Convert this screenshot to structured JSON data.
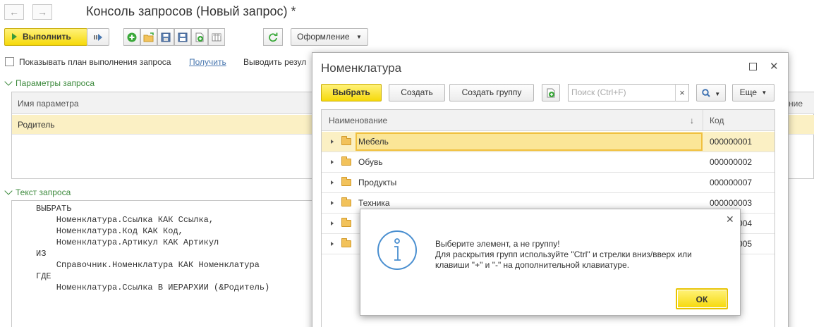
{
  "window": {
    "title": "Консоль запросов (Новый запрос) *",
    "nav_back": "←",
    "nav_forward": "→"
  },
  "toolbar": {
    "execute_label": "Выполнить",
    "format_label": "Оформление"
  },
  "options": {
    "show_plan_label": "Показывать план выполнения запроса",
    "get_link": "Получить",
    "output_result_label": "Выводить резул"
  },
  "params": {
    "section_label": "Параметры запроса",
    "col_name": "Имя параметра",
    "col_value_tail": "ние",
    "rows": [
      {
        "name": "Родитель"
      }
    ]
  },
  "query": {
    "section_label": "Текст запроса",
    "lines": [
      "ВЫБРАТЬ",
      "    Номенклатура.Ссылка КАК Ссылка,",
      "    Номенклатура.Код КАК Код,",
      "    Номенклатура.Артикул КАК Артикул",
      "ИЗ",
      "    Справочник.Номенклатура КАК Номенклатура",
      "ГДЕ",
      "    Номенклатура.Ссылка В ИЕРАРХИИ (&Родитель)"
    ]
  },
  "dialog": {
    "title": "Номенклатура",
    "select_label": "Выбрать",
    "create_label": "Создать",
    "create_group_label": "Создать группу",
    "search_placeholder": "Поиск (Ctrl+F)",
    "clear_glyph": "×",
    "more_label": "Еще",
    "col_name": "Наименование",
    "col_code": "Код",
    "sort_glyph": "↓",
    "rows": [
      {
        "name": "Мебель",
        "code": "000000001"
      },
      {
        "name": "Обувь",
        "code": "000000002"
      },
      {
        "name": "Продукты",
        "code": "000000007"
      },
      {
        "name": "Техника",
        "code": "000000003"
      },
      {
        "name": "",
        "code": "000000004"
      },
      {
        "name": "",
        "code": "000000005"
      }
    ]
  },
  "message": {
    "line1": "Выберите элемент, а не группу!",
    "line2": "Для раскрытия групп используйте \"Ctrl\" и стрелки вниз/вверх или",
    "line3": "клавиши \"+\" и \"-\" на дополнительной клавиатуре.",
    "ok_label": "ОК"
  },
  "colors": {
    "accent_yellow": "#f6d90a",
    "section_green": "#3d8a3d",
    "link_blue": "#4a78b0",
    "info_blue": "#4a8fd0"
  }
}
